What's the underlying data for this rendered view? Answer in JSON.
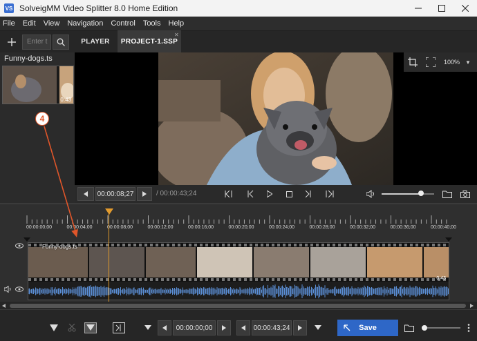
{
  "window": {
    "title": "SolveigMM Video Splitter 8.0 Home Edition",
    "app_icon_text": "VS",
    "controls": [
      "minimize",
      "maximize",
      "close"
    ]
  },
  "menu": [
    "File",
    "Edit",
    "View",
    "Navigation",
    "Control",
    "Tools",
    "Help"
  ],
  "toolbar": {
    "search_placeholder": "Enter t",
    "tabs": [
      {
        "label": "PLAYER",
        "active": false
      },
      {
        "label": "PROJECT-1.SSP",
        "active": true
      }
    ]
  },
  "media": {
    "file_name": "Funny-dogs.ts",
    "thumb_duration": "0:43"
  },
  "viewer": {
    "zoom": "100%"
  },
  "player_controls": {
    "current_time": "00:00:08;27",
    "duration": "/ 00:00:43;24",
    "volume_level": 0.75
  },
  "timeline": {
    "ticks": [
      "00:00:00;00",
      "00:00:04;00",
      "00:00:08;00",
      "00:00:12;00",
      "00:00:16;00",
      "00:00:20;00",
      "00:00:24;00",
      "00:00:28;00",
      "00:00:32;00",
      "00:00:36;00",
      "00:00:40;00"
    ],
    "clip_name": "Funny-dogs.ts",
    "clip_duration": "0:43",
    "playhead_time": "00:00:08;27"
  },
  "bottom": {
    "start_time": "00:00:00;00",
    "end_time": "00:00:43;24",
    "save_label": "Save"
  },
  "annotation": {
    "number": "4"
  },
  "colors": {
    "accent_blue": "#2e67c7",
    "playhead_orange": "#e39b2e",
    "callout_red": "#e0562a",
    "waveform_blue": "#5b8fd6"
  }
}
